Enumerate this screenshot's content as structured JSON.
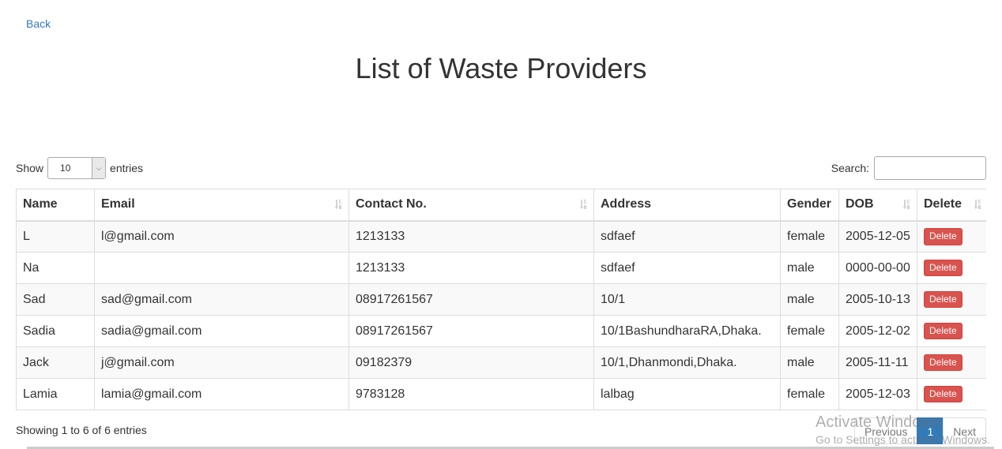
{
  "nav": {
    "back_label": "Back"
  },
  "page": {
    "title": "List of Waste Providers"
  },
  "length_control": {
    "show_label": "Show",
    "selected": "10",
    "entries_label": "entries"
  },
  "search": {
    "label": "Search:",
    "value": ""
  },
  "table": {
    "columns": [
      "Name",
      "Email",
      "Contact No.",
      "Address",
      "Gender",
      "DOB",
      "Delete"
    ],
    "rows": [
      {
        "name": "L",
        "email": "l@gmail.com",
        "contact": "1213133",
        "address": "sdfaef",
        "gender": "female",
        "dob": "2005-12-05",
        "action": "Delete"
      },
      {
        "name": "Na",
        "email": "",
        "contact": "1213133",
        "address": "sdfaef",
        "gender": "male",
        "dob": "0000-00-00",
        "action": "Delete"
      },
      {
        "name": "Sad",
        "email": "sad@gmail.com",
        "contact": "08917261567",
        "address": "10/1",
        "gender": "male",
        "dob": "2005-10-13",
        "action": "Delete"
      },
      {
        "name": "Sadia",
        "email": "sadia@gmail.com",
        "contact": "08917261567",
        "address": "10/1BashundharaRA,Dhaka.",
        "gender": "female",
        "dob": "2005-12-02",
        "action": "Delete"
      },
      {
        "name": "Jack",
        "email": "j@gmail.com",
        "contact": "09182379",
        "address": "10/1,Dhanmondi,Dhaka.",
        "gender": "male",
        "dob": "2005-11-11",
        "action": "Delete"
      },
      {
        "name": "Lamia",
        "email": "lamia@gmail.com",
        "contact": "9783128",
        "address": "lalbag",
        "gender": "female",
        "dob": "2005-12-03",
        "action": "Delete"
      }
    ]
  },
  "info": {
    "text": "Showing 1 to 6 of 6 entries"
  },
  "pagination": {
    "previous": "Previous",
    "current": "1",
    "next": "Next"
  },
  "watermark": {
    "title": "Activate Windows",
    "subtitle": "Go to Settings to activate Windows."
  }
}
